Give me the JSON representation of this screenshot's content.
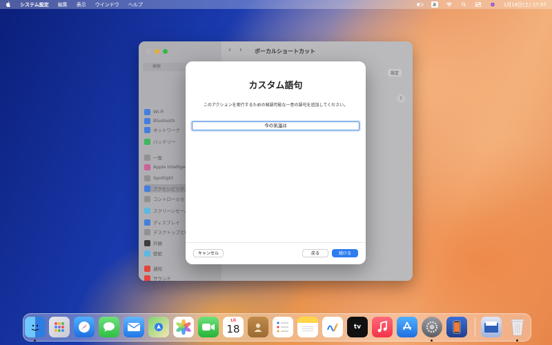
{
  "menubar": {
    "app_name": "システム設定",
    "menus": [
      "編集",
      "表示",
      "ウインドウ",
      "ヘルプ"
    ],
    "input_indicator": "あ",
    "datetime": "1月18日(土)  17:57"
  },
  "settings_window": {
    "title": "ボーカルショートカット",
    "search_placeholder": "検索",
    "settings_button": "設定",
    "help_button": "?",
    "sidebar_items": [
      "Wi-Fi",
      "Bluetooth",
      "ネットワーク",
      "バッテリー",
      "一般",
      "Apple Intelligence",
      "Spotlight",
      "アクセシビリティ",
      "コントロールセンター",
      "スクリーンセーバ",
      "ディスプレイ",
      "デスクトップとDock",
      "外観",
      "壁紙",
      "通知",
      "サウンド"
    ]
  },
  "dialog": {
    "title": "カスタム語句",
    "description": "このアクションを実行するための発語可能な一意の語句を追加してください。",
    "phrase_value": "今の気温は",
    "cancel_label": "キャンセル",
    "back_label": "戻る",
    "continue_label": "続ける"
  },
  "dock": {
    "calendar_month": "1月",
    "calendar_day": "18",
    "tv_label": "tv",
    "items": [
      "finder-icon",
      "launchpad-icon",
      "safari-icon",
      "messages-icon",
      "mail-icon",
      "maps-icon",
      "photos-icon",
      "facetime-icon",
      "calendar-icon",
      "contacts-icon",
      "reminders-icon",
      "notes-icon",
      "freeform-icon",
      "appletv-icon",
      "music-icon",
      "appstore-icon",
      "system-settings-icon",
      "iphone-mirroring-icon",
      "downloads-icon",
      "trash-icon"
    ]
  },
  "colors": {
    "accent": "#2d7df0",
    "traffic_red": "#ff5f57",
    "traffic_yellow": "#febc2e",
    "traffic_green": "#28c840"
  }
}
